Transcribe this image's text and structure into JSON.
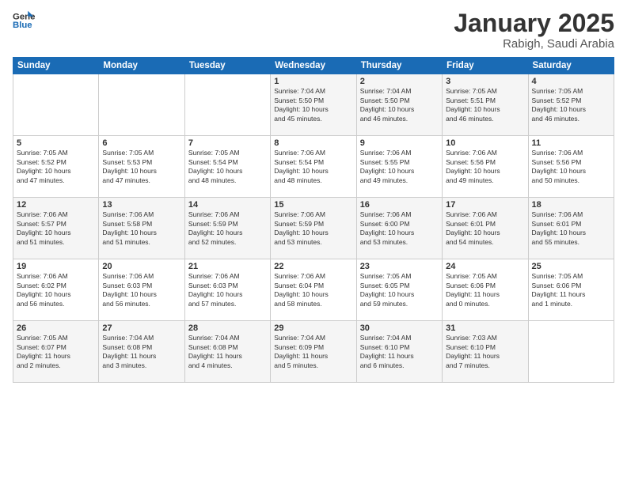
{
  "logo": {
    "line1": "General",
    "line2": "Blue"
  },
  "title": "January 2025",
  "subtitle": "Rabigh, Saudi Arabia",
  "weekdays": [
    "Sunday",
    "Monday",
    "Tuesday",
    "Wednesday",
    "Thursday",
    "Friday",
    "Saturday"
  ],
  "weeks": [
    [
      {
        "day": "",
        "text": ""
      },
      {
        "day": "",
        "text": ""
      },
      {
        "day": "",
        "text": ""
      },
      {
        "day": "1",
        "text": "Sunrise: 7:04 AM\nSunset: 5:50 PM\nDaylight: 10 hours\nand 45 minutes."
      },
      {
        "day": "2",
        "text": "Sunrise: 7:04 AM\nSunset: 5:50 PM\nDaylight: 10 hours\nand 46 minutes."
      },
      {
        "day": "3",
        "text": "Sunrise: 7:05 AM\nSunset: 5:51 PM\nDaylight: 10 hours\nand 46 minutes."
      },
      {
        "day": "4",
        "text": "Sunrise: 7:05 AM\nSunset: 5:52 PM\nDaylight: 10 hours\nand 46 minutes."
      }
    ],
    [
      {
        "day": "5",
        "text": "Sunrise: 7:05 AM\nSunset: 5:52 PM\nDaylight: 10 hours\nand 47 minutes."
      },
      {
        "day": "6",
        "text": "Sunrise: 7:05 AM\nSunset: 5:53 PM\nDaylight: 10 hours\nand 47 minutes."
      },
      {
        "day": "7",
        "text": "Sunrise: 7:05 AM\nSunset: 5:54 PM\nDaylight: 10 hours\nand 48 minutes."
      },
      {
        "day": "8",
        "text": "Sunrise: 7:06 AM\nSunset: 5:54 PM\nDaylight: 10 hours\nand 48 minutes."
      },
      {
        "day": "9",
        "text": "Sunrise: 7:06 AM\nSunset: 5:55 PM\nDaylight: 10 hours\nand 49 minutes."
      },
      {
        "day": "10",
        "text": "Sunrise: 7:06 AM\nSunset: 5:56 PM\nDaylight: 10 hours\nand 49 minutes."
      },
      {
        "day": "11",
        "text": "Sunrise: 7:06 AM\nSunset: 5:56 PM\nDaylight: 10 hours\nand 50 minutes."
      }
    ],
    [
      {
        "day": "12",
        "text": "Sunrise: 7:06 AM\nSunset: 5:57 PM\nDaylight: 10 hours\nand 51 minutes."
      },
      {
        "day": "13",
        "text": "Sunrise: 7:06 AM\nSunset: 5:58 PM\nDaylight: 10 hours\nand 51 minutes."
      },
      {
        "day": "14",
        "text": "Sunrise: 7:06 AM\nSunset: 5:59 PM\nDaylight: 10 hours\nand 52 minutes."
      },
      {
        "day": "15",
        "text": "Sunrise: 7:06 AM\nSunset: 5:59 PM\nDaylight: 10 hours\nand 53 minutes."
      },
      {
        "day": "16",
        "text": "Sunrise: 7:06 AM\nSunset: 6:00 PM\nDaylight: 10 hours\nand 53 minutes."
      },
      {
        "day": "17",
        "text": "Sunrise: 7:06 AM\nSunset: 6:01 PM\nDaylight: 10 hours\nand 54 minutes."
      },
      {
        "day": "18",
        "text": "Sunrise: 7:06 AM\nSunset: 6:01 PM\nDaylight: 10 hours\nand 55 minutes."
      }
    ],
    [
      {
        "day": "19",
        "text": "Sunrise: 7:06 AM\nSunset: 6:02 PM\nDaylight: 10 hours\nand 56 minutes."
      },
      {
        "day": "20",
        "text": "Sunrise: 7:06 AM\nSunset: 6:03 PM\nDaylight: 10 hours\nand 56 minutes."
      },
      {
        "day": "21",
        "text": "Sunrise: 7:06 AM\nSunset: 6:03 PM\nDaylight: 10 hours\nand 57 minutes."
      },
      {
        "day": "22",
        "text": "Sunrise: 7:06 AM\nSunset: 6:04 PM\nDaylight: 10 hours\nand 58 minutes."
      },
      {
        "day": "23",
        "text": "Sunrise: 7:05 AM\nSunset: 6:05 PM\nDaylight: 10 hours\nand 59 minutes."
      },
      {
        "day": "24",
        "text": "Sunrise: 7:05 AM\nSunset: 6:06 PM\nDaylight: 11 hours\nand 0 minutes."
      },
      {
        "day": "25",
        "text": "Sunrise: 7:05 AM\nSunset: 6:06 PM\nDaylight: 11 hours\nand 1 minute."
      }
    ],
    [
      {
        "day": "26",
        "text": "Sunrise: 7:05 AM\nSunset: 6:07 PM\nDaylight: 11 hours\nand 2 minutes."
      },
      {
        "day": "27",
        "text": "Sunrise: 7:04 AM\nSunset: 6:08 PM\nDaylight: 11 hours\nand 3 minutes."
      },
      {
        "day": "28",
        "text": "Sunrise: 7:04 AM\nSunset: 6:08 PM\nDaylight: 11 hours\nand 4 minutes."
      },
      {
        "day": "29",
        "text": "Sunrise: 7:04 AM\nSunset: 6:09 PM\nDaylight: 11 hours\nand 5 minutes."
      },
      {
        "day": "30",
        "text": "Sunrise: 7:04 AM\nSunset: 6:10 PM\nDaylight: 11 hours\nand 6 minutes."
      },
      {
        "day": "31",
        "text": "Sunrise: 7:03 AM\nSunset: 6:10 PM\nDaylight: 11 hours\nand 7 minutes."
      },
      {
        "day": "",
        "text": ""
      }
    ]
  ]
}
